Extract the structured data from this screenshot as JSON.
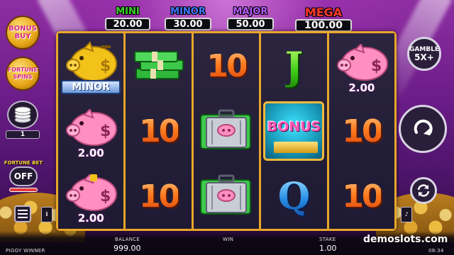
{
  "jackpots": [
    {
      "label": "MINI",
      "value": "20.00",
      "color": "#3bd42a"
    },
    {
      "label": "MINOR",
      "value": "30.00",
      "color": "#3f7bff"
    },
    {
      "label": "MAJOR",
      "value": "50.00",
      "color": "#b45cff"
    },
    {
      "label": "MEGA",
      "value": "100.00",
      "color": "#ff3b2a"
    }
  ],
  "left_panel": {
    "bonus_buy_line1": "BONUS",
    "bonus_buy_line2": "BUY",
    "fortune_spins_line1": "FORTUNE",
    "fortune_spins_line2": "SPINS",
    "coin_value": "1",
    "fortune_bet_label": "FORTUNE BET",
    "fortune_bet_state": "OFF"
  },
  "right_panel": {
    "gamble_label": "GAMBLE",
    "gamble_multiplier": "5X+",
    "spin_icon": "refresh-arrow-icon",
    "autoplay_icon": "autoplay-icon"
  },
  "reels": {
    "col1": [
      {
        "symbol": "gold-pig",
        "tag": "MINOR"
      },
      {
        "symbol": "pink-pig",
        "value": "2.00"
      },
      {
        "symbol": "pink-pig",
        "value": "2.00"
      }
    ],
    "col2": [
      {
        "symbol": "cash-stack"
      },
      {
        "symbol": "ten",
        "text": "10"
      },
      {
        "symbol": "ten",
        "text": "10"
      }
    ],
    "col3": [
      {
        "symbol": "ten",
        "text": "10"
      },
      {
        "symbol": "cash-case"
      },
      {
        "symbol": "cash-case"
      }
    ],
    "col4": [
      {
        "symbol": "jack",
        "text": "J"
      },
      {
        "symbol": "bonus",
        "text": "BONUS"
      },
      {
        "symbol": "queen",
        "text": "Q"
      }
    ],
    "col5": [
      {
        "symbol": "pink-pig",
        "value": "2.00"
      },
      {
        "symbol": "ten",
        "text": "10"
      },
      {
        "symbol": "ten",
        "text": "10"
      }
    ]
  },
  "bottom_bar": {
    "game_name": "PIGGY WINNER",
    "balance_label": "BALANCE",
    "balance_value": "999.00",
    "win_label": "WIN",
    "win_value": "",
    "stake_label": "STAKE",
    "stake_value": "1.00",
    "watermark": "demoslots.com",
    "clock": "08:34"
  }
}
